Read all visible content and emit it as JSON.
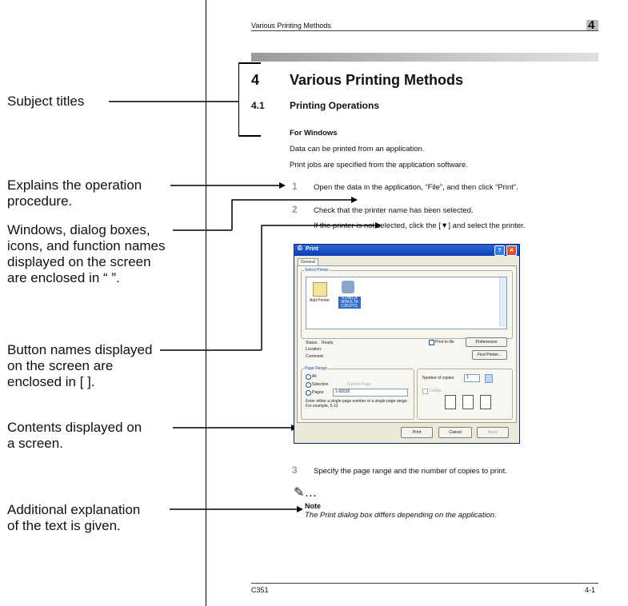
{
  "annotations": {
    "subject_titles": "Subject titles",
    "explains_1": "Explains the operation",
    "explains_2": "procedure.",
    "windows_1": "Windows, dialog boxes,",
    "windows_2": "icons, and function names",
    "windows_3": "displayed on the screen",
    "windows_4": "are enclosed in “ ”.",
    "buttons_1": "Button names displayed",
    "buttons_2": "on the screen are",
    "buttons_3": "enclosed in [  ].",
    "contents_1": "Contents displayed on",
    "contents_2": "a screen.",
    "additional_1": "Additional explanation",
    "additional_2": "of the text is given."
  },
  "page": {
    "header_title": "Various Printing Methods",
    "chapter_number": "4",
    "heading_number": "4",
    "heading_title": "Various Printing Methods",
    "section_number": "4.1",
    "section_title": "Printing Operations",
    "subheading": "For Windows",
    "intro_1": "Data can be printed from an application.",
    "intro_2": "Print jobs are specified from the application software.",
    "steps": [
      {
        "num": "1",
        "text": "Open the data in the application, “File”, and then click “Print”."
      },
      {
        "num": "2",
        "text": "Check that the printer name has been selected.",
        "text2": "If the printer is not selected, click the [▼] and select the printer."
      },
      {
        "num": "3",
        "text": "Specify the page range and the number of copies to print."
      }
    ],
    "note_icon": "✎…",
    "note_label": "Note",
    "note_text": "The Print dialog box differs depending on the application.",
    "footer_left": "C351",
    "footer_right": "4-1"
  },
  "dialog": {
    "title": "Print",
    "tab": "General",
    "select_printer": "Select Printer",
    "add_printer": "Add Printer",
    "printer_name": "KONICA MINOLTA C351PCL",
    "status_label": "Status:",
    "status_value": "Ready",
    "location_label": "Location:",
    "comment_label": "Comment:",
    "print_to_file": "Print to file",
    "preferences": "Preferences",
    "find_printer": "Find Printer...",
    "page_range": "Page Range",
    "all": "All",
    "selection": "Selection",
    "current_page": "Current Page",
    "pages": "Pages:",
    "pages_value": "1-65535",
    "range_help": "Enter either a single page number or a single page range. For example, 5-12",
    "copies_label": "Number of copies:",
    "copies_value": "1",
    "collate": "Collate",
    "print_btn": "Print",
    "cancel_btn": "Cancel",
    "apply_btn": "Apply"
  }
}
